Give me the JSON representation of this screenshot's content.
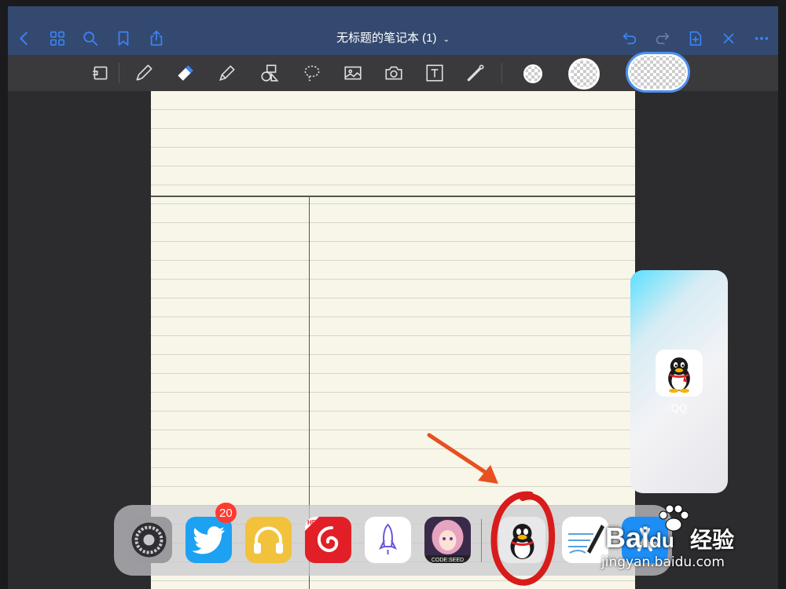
{
  "window": {
    "title": "无标题的笔记本 (1)"
  },
  "topbar": {
    "left_icons": [
      "back-chevron-icon",
      "grid-icon",
      "search-icon",
      "bookmark-icon",
      "share-icon"
    ],
    "right_icons": [
      "undo-icon",
      "redo-icon",
      "add-page-icon",
      "close-icon",
      "more-icon"
    ],
    "accent": "#3b82f6",
    "background": "#34496f"
  },
  "toolbar": {
    "tools": [
      "read-mode-icon",
      "pen-icon",
      "eraser-icon",
      "highlighter-icon",
      "shapes-icon",
      "lasso-icon",
      "image-icon",
      "camera-icon",
      "text-icon",
      "laser-icon"
    ],
    "active_tool": "eraser-icon",
    "swatches": [
      "small",
      "medium",
      "large-selected"
    ]
  },
  "paper": {
    "color": "#f8f6e8",
    "layout": "cornell"
  },
  "slideover": {
    "app_label": "QQ"
  },
  "dock": {
    "apps": [
      "Settings",
      "Twitter",
      "Music",
      "NetEase Cloud Music HD",
      "Shadowrocket",
      "Code:Seed",
      "QQ",
      "GoodNotes",
      "App Store"
    ],
    "twitter_badge": "20",
    "codeseed_caption": "CODE:SEED"
  },
  "annotations": {
    "arrow_color": "#e8501f",
    "circle_color": "#d81b1b"
  },
  "watermark": {
    "brand": "Bai",
    "brand_suffix": "du",
    "cn": "经验",
    "url": "jingyan.baidu.com"
  }
}
